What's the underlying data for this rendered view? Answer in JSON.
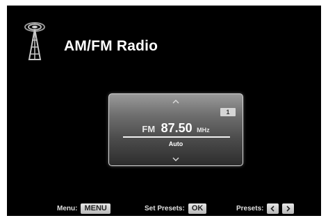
{
  "app": {
    "title": "AM/FM Radio"
  },
  "tuner": {
    "band": "FM",
    "frequency": "87.50",
    "unit": "MHz",
    "mode": "Auto",
    "preset_number": "1"
  },
  "footer": {
    "menu_label": "Menu:",
    "menu_key": "MENU",
    "set_presets_label": "Set Presets:",
    "set_presets_key": "OK",
    "presets_label": "Presets:"
  },
  "icons": {
    "header": "radio-tower-icon",
    "up": "chevron-up-icon",
    "down": "chevron-down-icon",
    "prev": "chevron-left-icon",
    "next": "chevron-right-icon"
  },
  "colors": {
    "background": "#000000",
    "panel_top": "#9a9a9a",
    "panel_bottom": "#2d2d2d",
    "text": "#ffffff",
    "key": "#d0d0d0"
  }
}
